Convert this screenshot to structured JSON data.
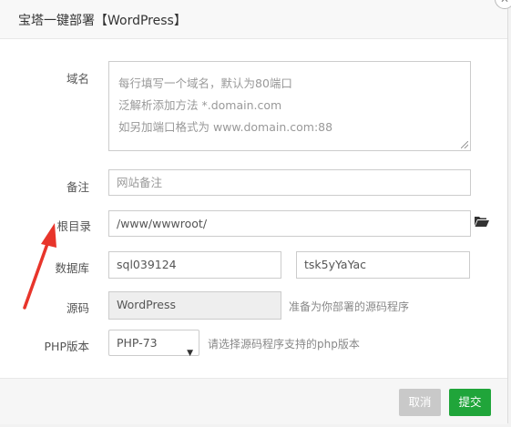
{
  "dialog": {
    "title": "宝塔一键部署【WordPress】"
  },
  "form": {
    "domain_label": "域名",
    "domain_placeholder_lines": [
      "每行填写一个域名，默认为80端口",
      "泛解析添加方法 *.domain.com",
      "如另加端口格式为 www.domain.com:88"
    ],
    "note_label": "备注",
    "note_placeholder": "网站备注",
    "root_label": "根目录",
    "root_value": "/www/wwwroot/",
    "db_label": "数据库",
    "db_name_value": "sql039124",
    "db_password_value": "tsk5yYaYac",
    "source_label": "源码",
    "source_value": "WordPress",
    "source_hint": "准备为你部署的源码程序",
    "php_label": "PHP版本",
    "php_selected": "PHP-73",
    "php_hint": "请选择源码程序支持的php版本"
  },
  "footer": {
    "cancel_label": "取消",
    "submit_label": "提交"
  },
  "colors": {
    "submit": "#20a53a",
    "cancel": "#c9c9c9",
    "annotation_arrow": "#e8352b"
  },
  "icons": {
    "folder": "folder-open-icon",
    "close": "close-icon"
  }
}
